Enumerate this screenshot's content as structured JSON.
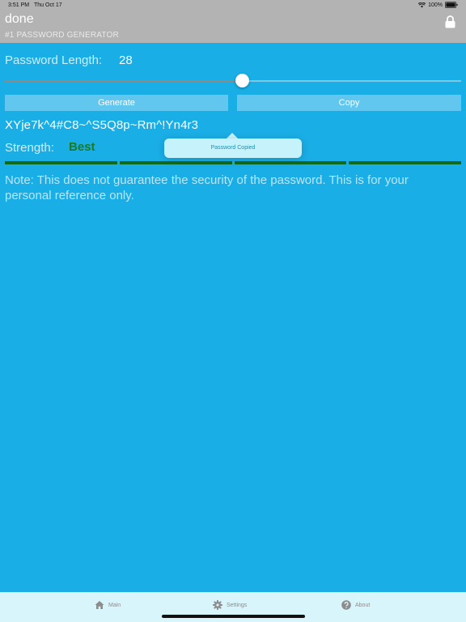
{
  "status_bar": {
    "time": "3:51 PM",
    "date": "Thu Oct 17",
    "battery": "100%",
    "wifi_icon": "wifi-icon",
    "battery_icon": "battery-icon"
  },
  "header": {
    "title": "done",
    "subtitle": "#1 PASSWORD GENERATOR",
    "lock_icon": "lock-icon"
  },
  "password_length": {
    "label": "Password Length:",
    "value": "28",
    "slider_fraction": 0.52
  },
  "buttons": {
    "generate_label": "Generate",
    "copy_label": "Copy"
  },
  "password": {
    "value": "XYje7k^4#C8~^S5Q8p~Rm^!Yn4r3"
  },
  "strength": {
    "label": "Strength:",
    "value": "Best",
    "segments_filled": 4,
    "segments_total": 4,
    "color": "#0f6b1c"
  },
  "note": {
    "text": "Note: This does not guarantee the security of the password. This is for your personal reference only."
  },
  "tooltip": {
    "text": "Password Copied"
  },
  "tabbar": {
    "tabs": [
      {
        "label": "Main",
        "icon": "home-icon"
      },
      {
        "label": "Settings",
        "icon": "gear-icon"
      },
      {
        "label": "About",
        "icon": "help-icon"
      }
    ]
  },
  "colors": {
    "background": "#1aaee6",
    "header": "#b3b3b3",
    "button": "#61c7ef",
    "strength_text": "#1a7a25"
  }
}
